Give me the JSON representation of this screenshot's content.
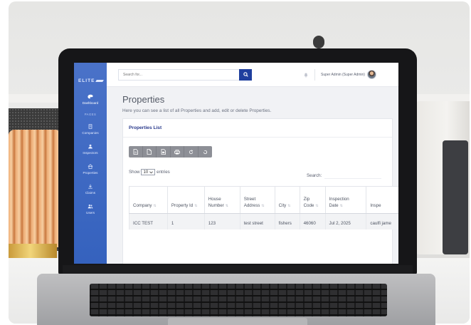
{
  "brand": {
    "logo_text": "ELITE"
  },
  "sidebar": {
    "items": [
      {
        "label": "Dashboard",
        "icon": "palette-icon",
        "active": true
      },
      {
        "label": "Companies",
        "icon": "building-icon"
      },
      {
        "label": "Inspectors",
        "icon": "person-icon"
      },
      {
        "label": "Properties",
        "icon": "home-icon"
      },
      {
        "label": "Claims",
        "icon": "download-icon"
      },
      {
        "label": "Users",
        "icon": "users-icon"
      }
    ],
    "section_heading": "PAGES"
  },
  "topbar": {
    "search_placeholder": "Search for...",
    "user_name": "Super Admin (Super Admin)"
  },
  "page": {
    "title": "Properties",
    "subtitle": "Here you can see a list of all Properties and add, edit or delete Properties."
  },
  "card": {
    "title": "Properties List",
    "toolbar_icons": [
      "copy-icon",
      "csv-icon",
      "pdf-icon",
      "print-icon",
      "refresh-icon",
      "reset-icon"
    ],
    "show_prefix": "Show",
    "entries_value": "10",
    "show_suffix": "entries",
    "search_label": "Search:"
  },
  "table": {
    "columns": [
      "Company",
      "Property Id",
      "House Number",
      "Street Address",
      "City",
      "Zip Code",
      "Inspection Date",
      "Inspe"
    ],
    "rows": [
      [
        "ICC TEST",
        "1",
        "123",
        "test street",
        "fishers",
        "46060",
        "Jul 2, 2025",
        "caulfi jame"
      ]
    ]
  },
  "colors": {
    "sidebar": "#3f68c4",
    "search_button": "#1f3f9e",
    "card_title": "#2a3a8c"
  }
}
